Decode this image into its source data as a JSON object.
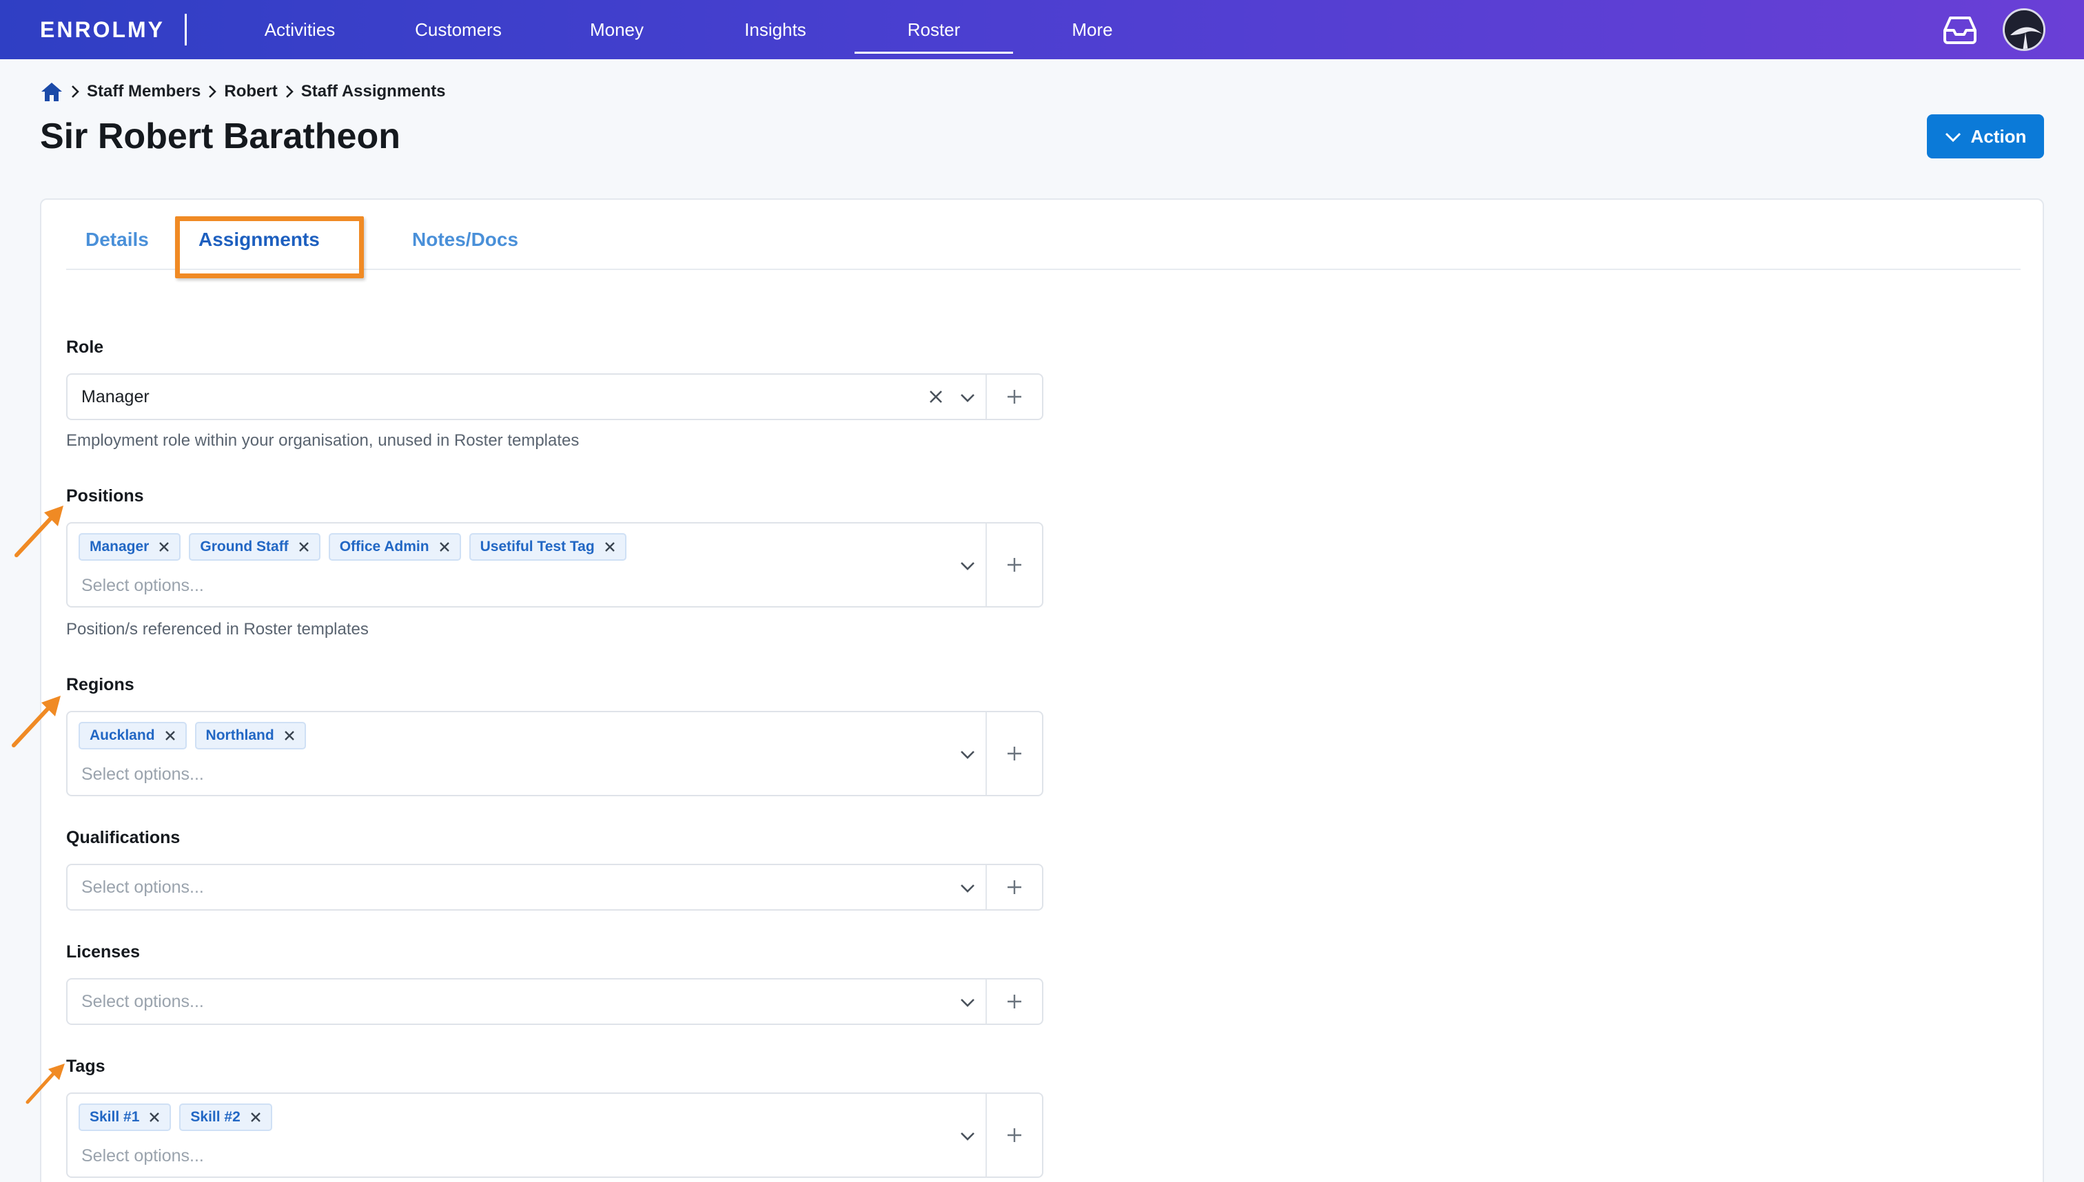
{
  "nav": {
    "logo": "ENROLMY",
    "links": [
      {
        "label": "Activities"
      },
      {
        "label": "Customers"
      },
      {
        "label": "Money"
      },
      {
        "label": "Insights"
      },
      {
        "label": "Roster",
        "active": true
      },
      {
        "label": "More"
      }
    ],
    "accent_gradient": [
      "#2f3fc4",
      "#6a3fd6"
    ]
  },
  "breadcrumb": {
    "home_icon": "home-icon",
    "items": [
      "Staff Members",
      "Robert",
      "Staff Assignments"
    ]
  },
  "page": {
    "title": "Sir Robert Baratheon",
    "action_label": "Action",
    "action_color": "#0b7ad8"
  },
  "tabs": [
    {
      "label": "Details"
    },
    {
      "label": "Assignments",
      "active": true,
      "highlighted": true
    },
    {
      "label": "Notes/Docs"
    }
  ],
  "form": {
    "role": {
      "label": "Role",
      "value": "Manager",
      "help": "Employment role within your organisation, unused in Roster templates"
    },
    "positions": {
      "label": "Positions",
      "chips": [
        "Manager",
        "Ground Staff",
        "Office Admin",
        "Usetiful Test Tag"
      ],
      "placeholder": "Select options...",
      "help": "Position/s referenced in Roster templates"
    },
    "regions": {
      "label": "Regions",
      "chips": [
        "Auckland",
        "Northland"
      ],
      "placeholder": "Select options..."
    },
    "qualifications": {
      "label": "Qualifications",
      "placeholder": "Select options..."
    },
    "licenses": {
      "label": "Licenses",
      "placeholder": "Select options..."
    },
    "tags": {
      "label": "Tags",
      "chips": [
        "Skill #1",
        "Skill #2"
      ],
      "placeholder": "Select options..."
    }
  },
  "annotation_color": "#f08a24"
}
